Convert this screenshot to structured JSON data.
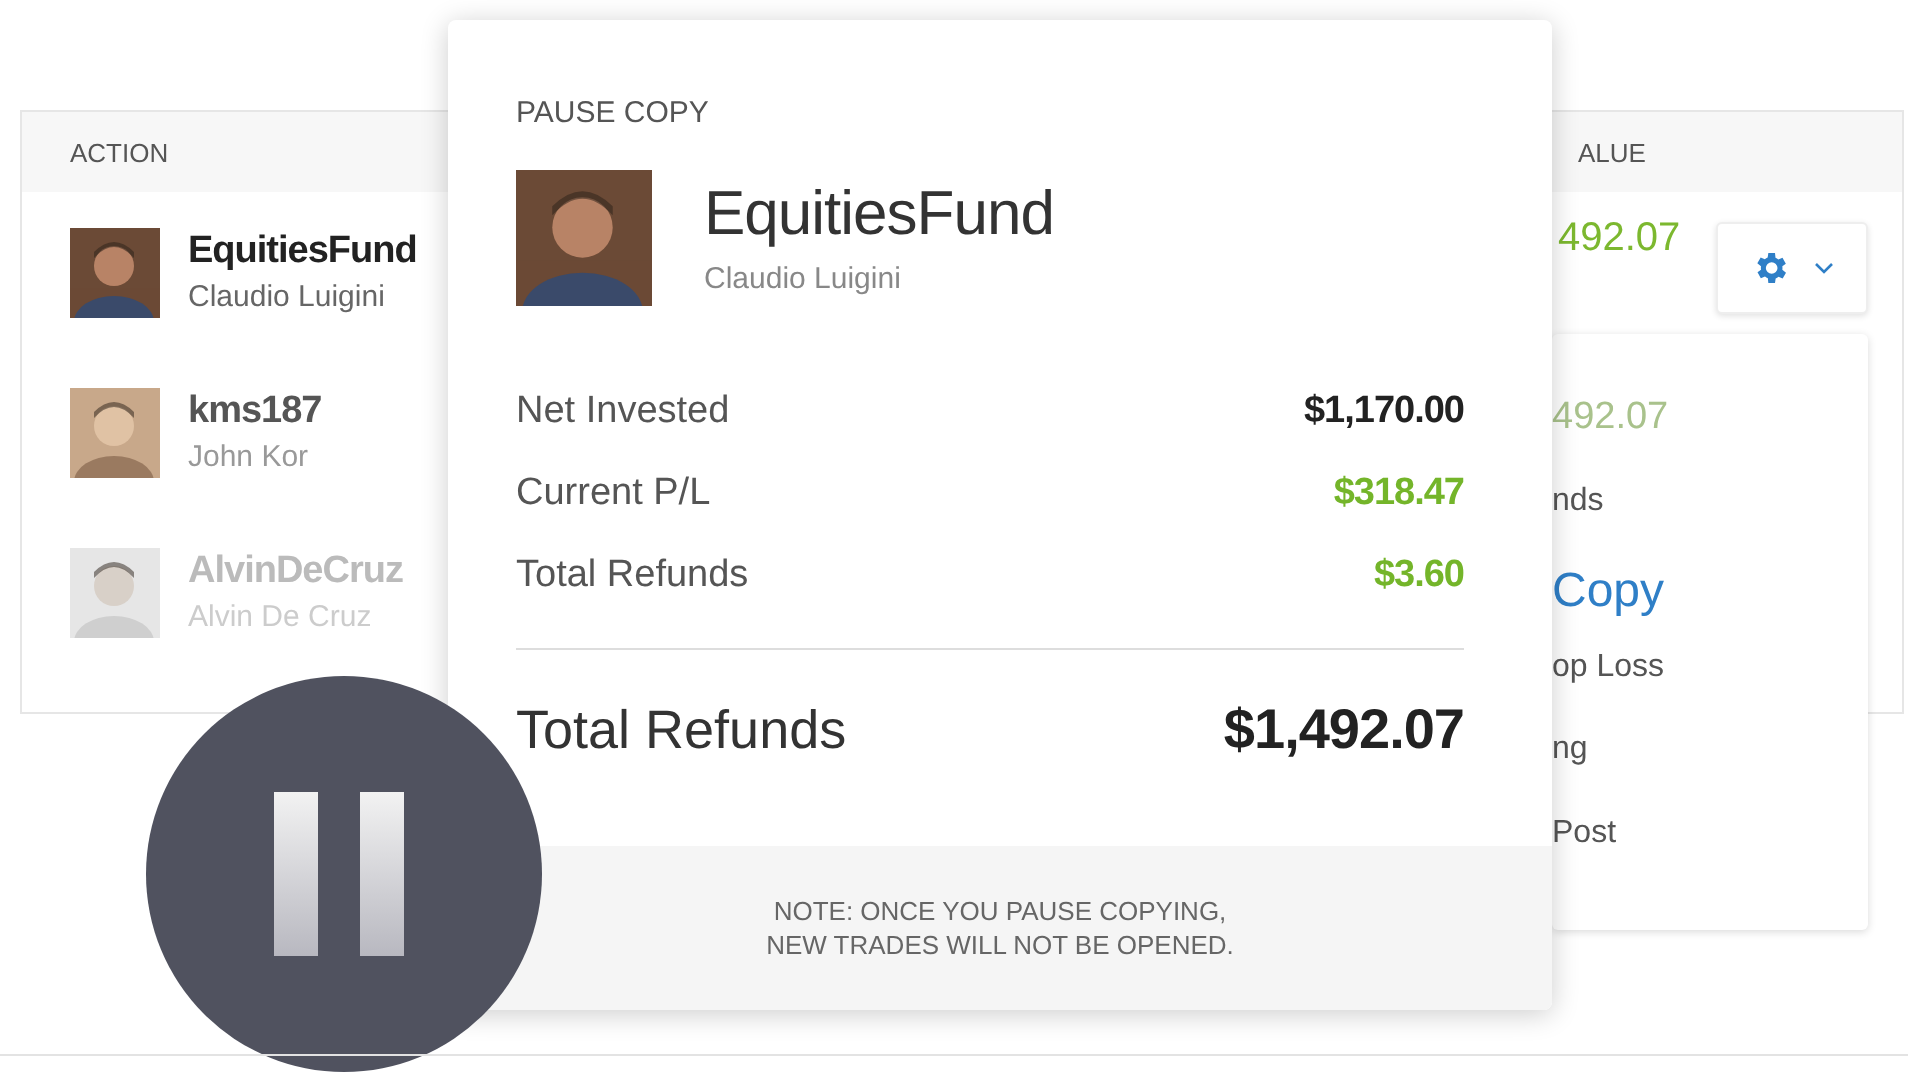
{
  "table": {
    "columns": [
      {
        "label": "ACTION"
      },
      {
        "label": "ALUE"
      }
    ],
    "rows": [
      {
        "username": "EquitiesFund",
        "full_name": "Claudio Luigini",
        "value": "492.07"
      },
      {
        "username": "kms187",
        "full_name": "John Kor"
      },
      {
        "username": "AlvinDeCruz",
        "full_name": "Alvin De Cruz"
      }
    ]
  },
  "settings_menu": {
    "items": [
      {
        "label": "492.07",
        "kind": "faded"
      },
      {
        "label": "nds",
        "kind": "plain"
      },
      {
        "label": "Copy",
        "kind": "highlight"
      },
      {
        "label": "op Loss",
        "kind": "plain"
      },
      {
        "label": "ng",
        "kind": "plain"
      },
      {
        "label": "Post",
        "kind": "plain"
      }
    ]
  },
  "dialog": {
    "title": "PAUSE COPY",
    "username": "EquitiesFund",
    "full_name": "Claudio Luigini",
    "rows": [
      {
        "label": "Net Invested",
        "value": "$1,170.00",
        "kind": "neutral"
      },
      {
        "label": "Current P/L",
        "value": "$318.47",
        "kind": "positive"
      },
      {
        "label": "Total Refunds",
        "value": "$3.60",
        "kind": "positive"
      }
    ],
    "total": {
      "label": "Total Refunds",
      "value": "$1,492.07"
    },
    "note": "NOTE: ONCE YOU PAUSE COPYING,\nNEW TRADES WILL NOT BE OPENED."
  }
}
